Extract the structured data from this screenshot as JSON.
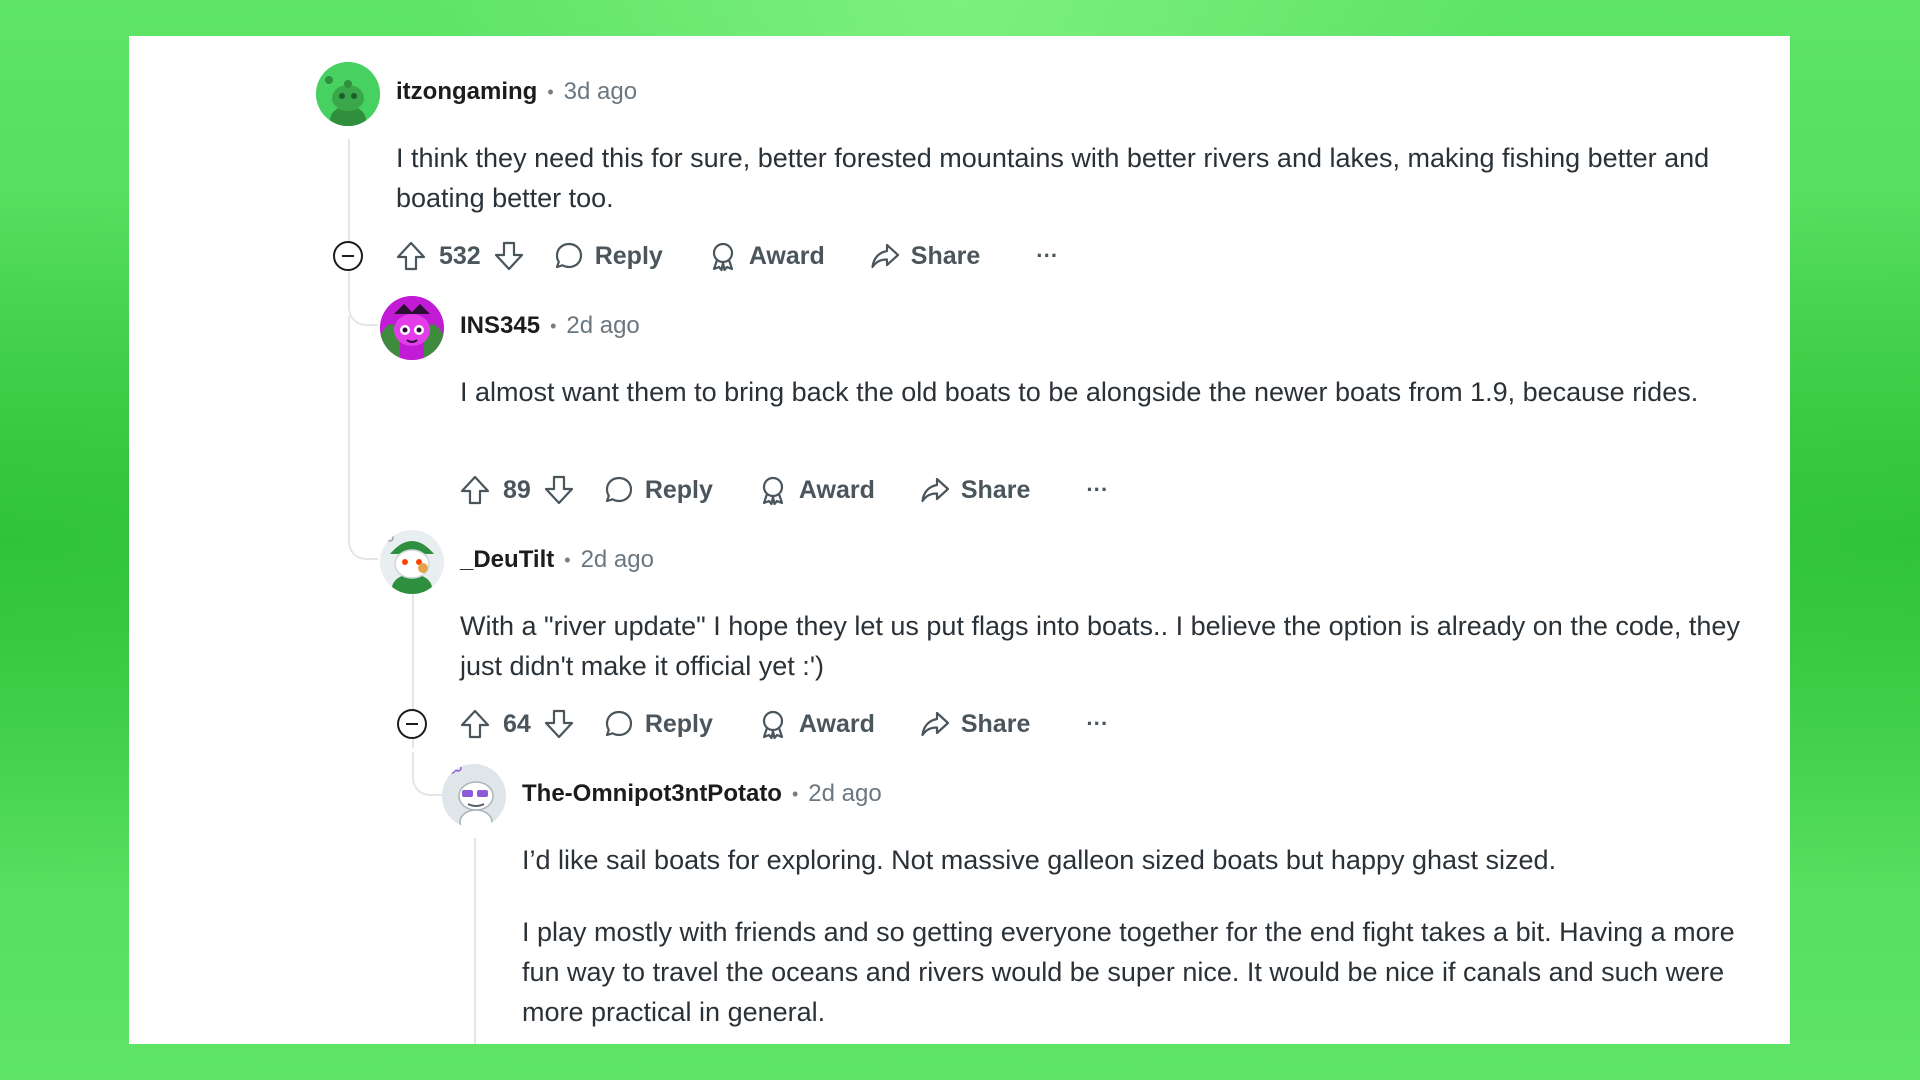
{
  "comments": [
    {
      "author": "itzongaming",
      "time": "3d ago",
      "body": [
        "I think they need this for sure, better forested mountains with better rivers and lakes, making fishing better and boating better too."
      ],
      "votes": "532",
      "avatar_color": "#46d160"
    },
    {
      "author": "INS345",
      "time": "2d ago",
      "body": [
        "I almost want them to bring back the old boats to be alongside the newer boats from 1.9, because rides."
      ],
      "votes": "89",
      "avatar_color": "#c11bd6"
    },
    {
      "author": "_DeuTilt",
      "time": "2d ago",
      "body": [
        "With a \"river update\" I hope they let us put flags into boats.. I believe the option is already on the code, they just didn't make it official yet :')"
      ],
      "votes": "64",
      "avatar_color": "#2e8f3e"
    },
    {
      "author": "The-Omnipot3ntPotato",
      "time": "2d ago",
      "body": [
        "I’d like sail boats for exploring. Not massive galleon sized boats but happy ghast sized.",
        "I play mostly with friends and so getting everyone together for the end fight takes a bit. Having a more fun way to travel the oceans and rivers would be super nice. It would be nice if canals and such were more practical in general."
      ],
      "avatar_color": "#dfe6ea"
    }
  ],
  "actions": {
    "reply": "Reply",
    "award": "Award",
    "share": "Share",
    "more": "···"
  },
  "dot": "•"
}
